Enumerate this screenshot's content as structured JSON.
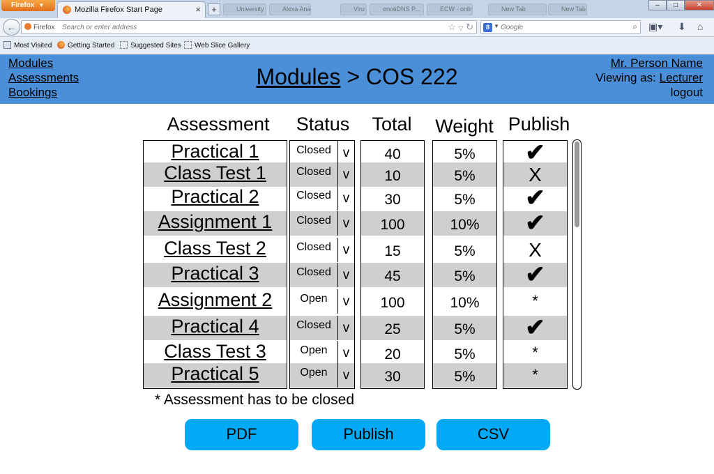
{
  "browser": {
    "menu_button": "Firefox",
    "active_tab": "Mozilla Firefox Start Page",
    "new_tab_symbol": "+",
    "background_tabs": [
      "University o...",
      "Alexa Analo...",
      "Viru",
      "enotiDNS P...",
      "ECW - online",
      "New Tab",
      "New Tab"
    ],
    "identity_label": "Firefox",
    "address_placeholder": "Search or enter address",
    "search_engine_letter": "8",
    "search_placeholder": "Google",
    "bookmarks": [
      "Most Visited",
      "Getting Started",
      "Suggested Sites",
      "Web Slice Gallery"
    ]
  },
  "app": {
    "nav": [
      "Modules",
      "Assessments",
      "Bookings"
    ],
    "title_crumb": "Modules",
    "title_separator": ">",
    "title_module": "COS 222",
    "user_name": "Mr. Person Name",
    "viewing_as_label": "Viewing as:",
    "role": "Lecturer",
    "logout": "logout"
  },
  "table": {
    "headers": {
      "assessment": "Assessment",
      "status": "Status",
      "total": "Total",
      "weight": "Weight",
      "publish": "Publish"
    },
    "dropdown_symbol": "v",
    "rows": [
      {
        "name": "Practical 1",
        "status": "Closed",
        "total": "40",
        "weight": "5%",
        "publish": "✔"
      },
      {
        "name": "Class Test 1",
        "status": "Closed",
        "total": "10",
        "weight": "5%",
        "publish": "X"
      },
      {
        "name": "Practical 2",
        "status": "Closed",
        "total": "30",
        "weight": "5%",
        "publish": "✔"
      },
      {
        "name": "Assignment 1",
        "status": "Closed",
        "total": "100",
        "weight": "10%",
        "publish": "✔"
      },
      {
        "name": "Class Test 2",
        "status": "Closed",
        "total": "15",
        "weight": "5%",
        "publish": "X"
      },
      {
        "name": "Practical 3",
        "status": "Closed",
        "total": "45",
        "weight": "5%",
        "publish": "✔"
      },
      {
        "name": "Assignment 2",
        "status": "Open",
        "total": "100",
        "weight": "10%",
        "publish": "*"
      },
      {
        "name": "Practical 4",
        "status": "Closed",
        "total": "25",
        "weight": "5%",
        "publish": "✔"
      },
      {
        "name": "Class Test 3",
        "status": "Open",
        "total": "20",
        "weight": "5%",
        "publish": "*"
      },
      {
        "name": "Practical 5",
        "status": "Open",
        "total": "30",
        "weight": "5%",
        "publish": "*"
      }
    ],
    "footnote": "* Assessment has to be closed"
  },
  "buttons": {
    "pdf": "PDF",
    "publish": "Publish",
    "csv": "CSV"
  }
}
